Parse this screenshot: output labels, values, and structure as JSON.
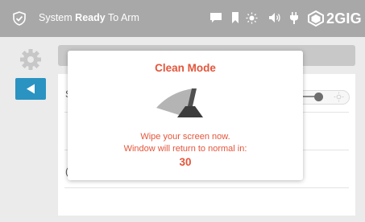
{
  "status_bar": {
    "status_prefix": "System",
    "status_bold": "Ready",
    "status_suffix": "To Arm",
    "icons": [
      "shield-check-icon",
      "message-icon",
      "bookmark-icon",
      "brightness-icon",
      "volume-icon",
      "plug-icon"
    ],
    "brand": "2GIG"
  },
  "sidebar": {
    "icons": [
      "gear-icon",
      "back-arrow-icon"
    ]
  },
  "settings_panel": {
    "row1_label": "S",
    "row2_label": "(",
    "brightness_level": 0.55
  },
  "clean_mode_dialog": {
    "title": "Clean Mode",
    "line1": "Wipe your screen now.",
    "line2": "Window will return to normal in:",
    "countdown": "30",
    "icon": "wiper-icon"
  },
  "colors": {
    "accent_red": "#e4553a",
    "back_button_blue": "#2a93c1",
    "status_bar_gray": "#a8a8a8"
  }
}
